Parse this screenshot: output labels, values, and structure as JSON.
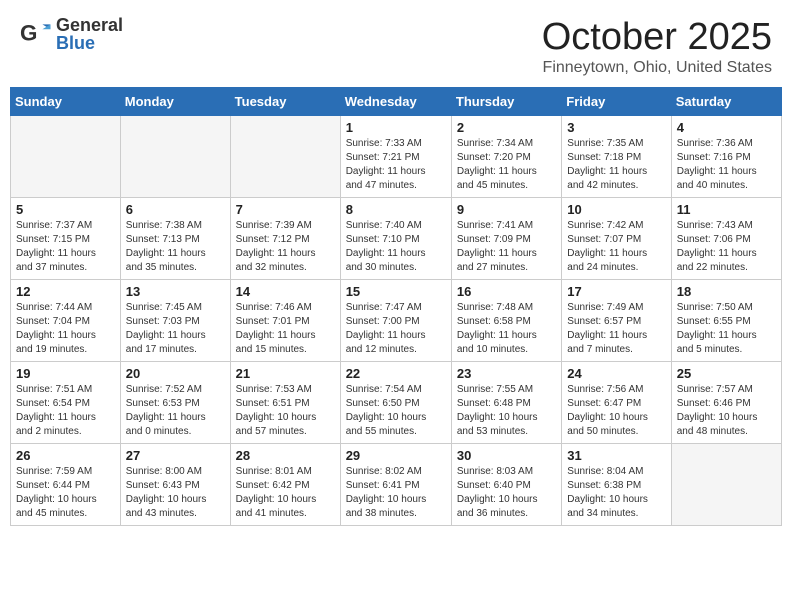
{
  "header": {
    "logo_general": "General",
    "logo_blue": "Blue",
    "month_title": "October 2025",
    "location": "Finneytown, Ohio, United States"
  },
  "days_of_week": [
    "Sunday",
    "Monday",
    "Tuesday",
    "Wednesday",
    "Thursday",
    "Friday",
    "Saturday"
  ],
  "weeks": [
    [
      {
        "day": "",
        "info": ""
      },
      {
        "day": "",
        "info": ""
      },
      {
        "day": "",
        "info": ""
      },
      {
        "day": "1",
        "info": "Sunrise: 7:33 AM\nSunset: 7:21 PM\nDaylight: 11 hours\nand 47 minutes."
      },
      {
        "day": "2",
        "info": "Sunrise: 7:34 AM\nSunset: 7:20 PM\nDaylight: 11 hours\nand 45 minutes."
      },
      {
        "day": "3",
        "info": "Sunrise: 7:35 AM\nSunset: 7:18 PM\nDaylight: 11 hours\nand 42 minutes."
      },
      {
        "day": "4",
        "info": "Sunrise: 7:36 AM\nSunset: 7:16 PM\nDaylight: 11 hours\nand 40 minutes."
      }
    ],
    [
      {
        "day": "5",
        "info": "Sunrise: 7:37 AM\nSunset: 7:15 PM\nDaylight: 11 hours\nand 37 minutes."
      },
      {
        "day": "6",
        "info": "Sunrise: 7:38 AM\nSunset: 7:13 PM\nDaylight: 11 hours\nand 35 minutes."
      },
      {
        "day": "7",
        "info": "Sunrise: 7:39 AM\nSunset: 7:12 PM\nDaylight: 11 hours\nand 32 minutes."
      },
      {
        "day": "8",
        "info": "Sunrise: 7:40 AM\nSunset: 7:10 PM\nDaylight: 11 hours\nand 30 minutes."
      },
      {
        "day": "9",
        "info": "Sunrise: 7:41 AM\nSunset: 7:09 PM\nDaylight: 11 hours\nand 27 minutes."
      },
      {
        "day": "10",
        "info": "Sunrise: 7:42 AM\nSunset: 7:07 PM\nDaylight: 11 hours\nand 24 minutes."
      },
      {
        "day": "11",
        "info": "Sunrise: 7:43 AM\nSunset: 7:06 PM\nDaylight: 11 hours\nand 22 minutes."
      }
    ],
    [
      {
        "day": "12",
        "info": "Sunrise: 7:44 AM\nSunset: 7:04 PM\nDaylight: 11 hours\nand 19 minutes."
      },
      {
        "day": "13",
        "info": "Sunrise: 7:45 AM\nSunset: 7:03 PM\nDaylight: 11 hours\nand 17 minutes."
      },
      {
        "day": "14",
        "info": "Sunrise: 7:46 AM\nSunset: 7:01 PM\nDaylight: 11 hours\nand 15 minutes."
      },
      {
        "day": "15",
        "info": "Sunrise: 7:47 AM\nSunset: 7:00 PM\nDaylight: 11 hours\nand 12 minutes."
      },
      {
        "day": "16",
        "info": "Sunrise: 7:48 AM\nSunset: 6:58 PM\nDaylight: 11 hours\nand 10 minutes."
      },
      {
        "day": "17",
        "info": "Sunrise: 7:49 AM\nSunset: 6:57 PM\nDaylight: 11 hours\nand 7 minutes."
      },
      {
        "day": "18",
        "info": "Sunrise: 7:50 AM\nSunset: 6:55 PM\nDaylight: 11 hours\nand 5 minutes."
      }
    ],
    [
      {
        "day": "19",
        "info": "Sunrise: 7:51 AM\nSunset: 6:54 PM\nDaylight: 11 hours\nand 2 minutes."
      },
      {
        "day": "20",
        "info": "Sunrise: 7:52 AM\nSunset: 6:53 PM\nDaylight: 11 hours\nand 0 minutes."
      },
      {
        "day": "21",
        "info": "Sunrise: 7:53 AM\nSunset: 6:51 PM\nDaylight: 10 hours\nand 57 minutes."
      },
      {
        "day": "22",
        "info": "Sunrise: 7:54 AM\nSunset: 6:50 PM\nDaylight: 10 hours\nand 55 minutes."
      },
      {
        "day": "23",
        "info": "Sunrise: 7:55 AM\nSunset: 6:48 PM\nDaylight: 10 hours\nand 53 minutes."
      },
      {
        "day": "24",
        "info": "Sunrise: 7:56 AM\nSunset: 6:47 PM\nDaylight: 10 hours\nand 50 minutes."
      },
      {
        "day": "25",
        "info": "Sunrise: 7:57 AM\nSunset: 6:46 PM\nDaylight: 10 hours\nand 48 minutes."
      }
    ],
    [
      {
        "day": "26",
        "info": "Sunrise: 7:59 AM\nSunset: 6:44 PM\nDaylight: 10 hours\nand 45 minutes."
      },
      {
        "day": "27",
        "info": "Sunrise: 8:00 AM\nSunset: 6:43 PM\nDaylight: 10 hours\nand 43 minutes."
      },
      {
        "day": "28",
        "info": "Sunrise: 8:01 AM\nSunset: 6:42 PM\nDaylight: 10 hours\nand 41 minutes."
      },
      {
        "day": "29",
        "info": "Sunrise: 8:02 AM\nSunset: 6:41 PM\nDaylight: 10 hours\nand 38 minutes."
      },
      {
        "day": "30",
        "info": "Sunrise: 8:03 AM\nSunset: 6:40 PM\nDaylight: 10 hours\nand 36 minutes."
      },
      {
        "day": "31",
        "info": "Sunrise: 8:04 AM\nSunset: 6:38 PM\nDaylight: 10 hours\nand 34 minutes."
      },
      {
        "day": "",
        "info": ""
      }
    ]
  ]
}
